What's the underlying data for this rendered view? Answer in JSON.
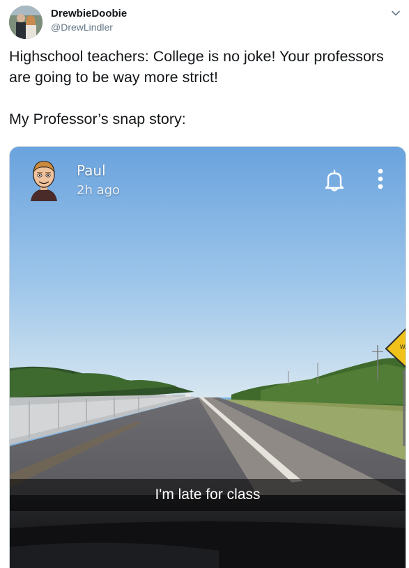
{
  "tweet": {
    "display_name": "DrewbieDoobie",
    "handle": "@DrewLindler",
    "text_line1": "Highschool teachers: College is no joke! Your professors are going to be way more strict!",
    "text_line2": "My Professor’s snap story:",
    "menu_icon": "chevron-down-icon"
  },
  "snap": {
    "user_name": "Paul",
    "time_ago": "2h ago",
    "caption": "I'm late for class",
    "icons": [
      "bitmoji-avatar",
      "bell-icon",
      "more-vertical-icon"
    ],
    "road_sign": "WAY"
  },
  "colors": {
    "name": "#14171a",
    "handle": "#657786",
    "sky_top": "#6fa6de",
    "sky_bottom": "#cfe2f1",
    "sign_yellow": "#f2c419"
  }
}
